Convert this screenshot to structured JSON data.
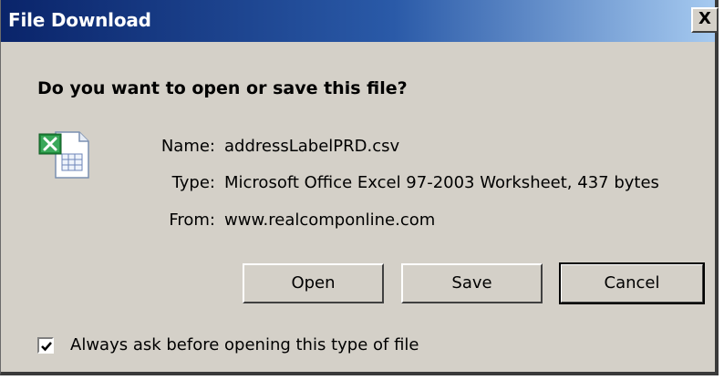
{
  "window": {
    "title": "File Download",
    "close_label": "X"
  },
  "dialog": {
    "question": "Do you want to open or save this file?",
    "file_icon": "excel-csv-file-icon",
    "fields": {
      "name_label": "Name:",
      "name_value": "addressLabelPRD.csv",
      "type_label": "Type:",
      "type_value": "Microsoft Office Excel 97-2003 Worksheet, 437 bytes",
      "from_label": "From:",
      "from_value": "www.realcomponline.com"
    },
    "buttons": {
      "open": "Open",
      "save": "Save",
      "cancel": "Cancel"
    },
    "always_ask": {
      "label": "Always ask before opening this type of file",
      "checked": true
    }
  },
  "colors": {
    "titlebar_start": "#0a246a",
    "titlebar_end": "#a6caf0",
    "dialog_bg": "#d4d0c8"
  }
}
